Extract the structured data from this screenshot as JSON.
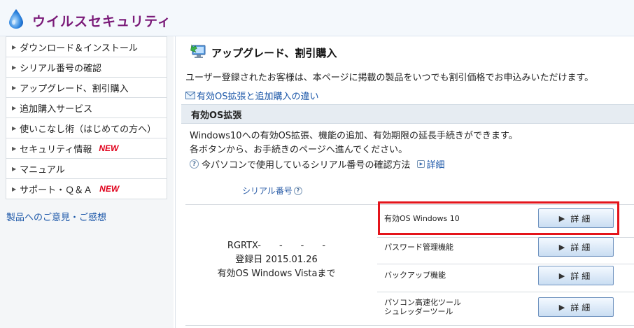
{
  "header": {
    "title": "ウイルスセキュリティ",
    "logo_icon": "water-drop-logo-icon"
  },
  "sidebar": {
    "items": [
      {
        "label": "ダウンロード＆インストール",
        "new": ""
      },
      {
        "label": "シリアル番号の確認",
        "new": ""
      },
      {
        "label": "アップグレード、割引購入",
        "new": ""
      },
      {
        "label": "追加購入サービス",
        "new": ""
      },
      {
        "label": "使いこなし術（はじめての方へ）",
        "new": ""
      },
      {
        "label": "セキュリティ情報",
        "new": "NEW"
      },
      {
        "label": "マニュアル",
        "new": ""
      },
      {
        "label": "サポート・Ｑ＆Ａ",
        "new": "NEW"
      }
    ],
    "feedback_link": "製品へのご意見・ご感想"
  },
  "main": {
    "title": "アップグレード、割引購入",
    "intro": "ユーザー登録されたお客様は、本ページに掲載の製品をいつでも割引価格でお申込みいただけます。",
    "diff_link": "有効OS拡張と追加購入の違い",
    "section_title": "有効OS拡張",
    "desc1": "Windows10への有効OS拡張、機能の追加、有効期限の延長手続きができます。",
    "desc2": "各ボタンから、お手続きのページへ進んでください。",
    "help_text": "今パソコンで使用しているシリアル番号の確認方法",
    "help_detail": "詳細",
    "serial_header": "シリアル番号",
    "serial": {
      "number": "RGRTX-　　-　　-　　-",
      "registered": "登録日 2015.01.26",
      "valid_os": "有効OS Windows Vistaまで"
    },
    "features": [
      {
        "label": "有効OS Windows 10",
        "button": "詳細",
        "highlighted": true
      },
      {
        "label": "パスワード管理機能",
        "button": "詳細",
        "highlighted": false
      },
      {
        "label": "バックアップ機能",
        "button": "詳細",
        "highlighted": false
      },
      {
        "label_line1": "パソコン高速化ツール",
        "label_line2": "シュレッダーツール",
        "button": "詳細",
        "highlighted": false
      }
    ]
  },
  "colors": {
    "brand": "#7a1a78",
    "link": "#1a56a8",
    "new_badge": "#e0001b",
    "highlight": "#e4141b"
  }
}
